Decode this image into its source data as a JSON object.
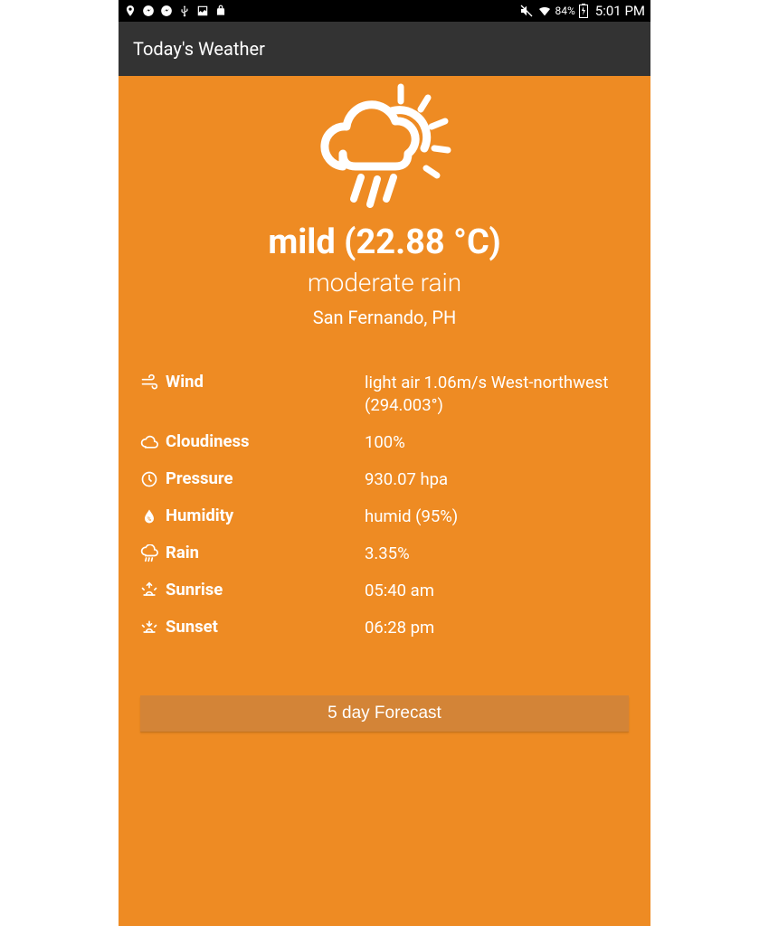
{
  "status_bar": {
    "battery_percent": "84%",
    "time": "5:01 PM"
  },
  "app_bar": {
    "title": "Today's Weather"
  },
  "hero": {
    "headline": "mild (22.88 °C)",
    "condition": "moderate rain",
    "location": "San Fernando, PH"
  },
  "metrics": [
    {
      "icon": "wind-icon",
      "label": "Wind",
      "value": "light air 1.06m/s West-northwest (294.003°)"
    },
    {
      "icon": "cloud-icon",
      "label": "Cloudiness",
      "value": "100%"
    },
    {
      "icon": "pressure-icon",
      "label": "Pressure",
      "value": "930.07 hpa"
    },
    {
      "icon": "humidity-icon",
      "label": "Humidity",
      "value": "humid (95%)"
    },
    {
      "icon": "rain-icon",
      "label": "Rain",
      "value": "3.35%"
    },
    {
      "icon": "sunrise-icon",
      "label": "Sunrise",
      "value": "05:40 am"
    },
    {
      "icon": "sunset-icon",
      "label": "Sunset",
      "value": "06:28 pm"
    }
  ],
  "forecast_button": {
    "label": "5 day Forecast"
  }
}
